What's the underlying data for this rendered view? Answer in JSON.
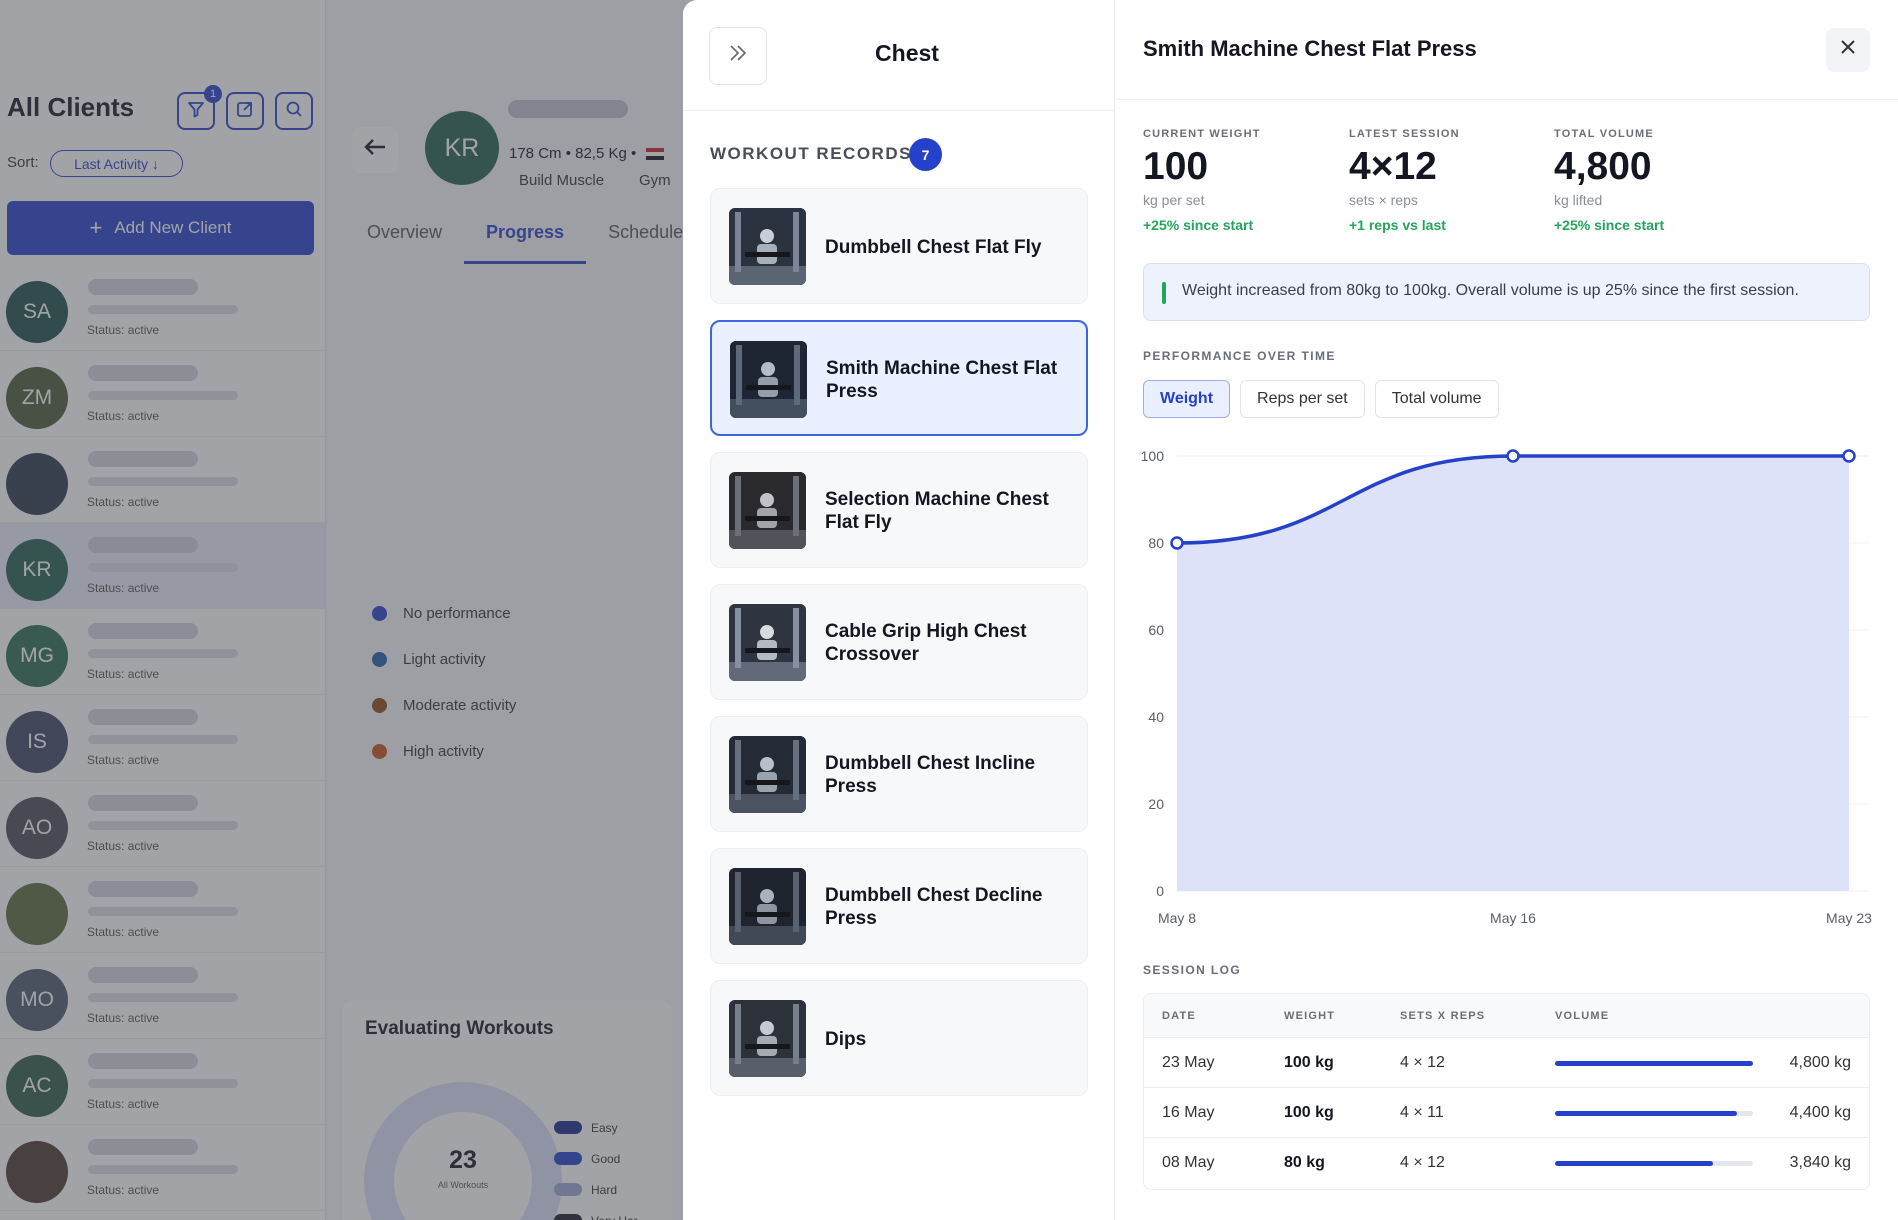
{
  "sidebar": {
    "title": "All Clients",
    "filter_badge": "1",
    "sort_label": "Sort:",
    "sort_value": "Last Activity ↓",
    "add_button": "Add New Client",
    "clients": [
      {
        "initials": "SA",
        "status": "Status: active",
        "color": "#1f4f49",
        "active": false
      },
      {
        "initials": "ZM",
        "status": "Status: active",
        "color": "#4c5a3a",
        "active": false
      },
      {
        "initials": "",
        "status": "Status: active",
        "color": "#2e3b4c",
        "active": false
      },
      {
        "initials": "KR",
        "status": "Status: active",
        "color": "#26604e",
        "active": true
      },
      {
        "initials": "MG",
        "status": "Status: active",
        "color": "#2d6a56",
        "active": false
      },
      {
        "initials": "IS",
        "status": "Status: active",
        "color": "#3c4560",
        "active": false
      },
      {
        "initials": "AO",
        "status": "Status: active",
        "color": "#4a4a55",
        "active": false
      },
      {
        "initials": "",
        "status": "Status: active",
        "color": "#5a6a3a",
        "active": false
      },
      {
        "initials": "MO",
        "status": "Status: active",
        "color": "#4a5a6a",
        "active": false
      },
      {
        "initials": "AC",
        "status": "Status: active",
        "color": "#2e5a4c",
        "active": false
      },
      {
        "initials": "",
        "status": "Status: active",
        "color": "#4c3a2e",
        "active": false
      }
    ]
  },
  "client": {
    "initials": "KR",
    "height": "178 Cm",
    "weight": "82,5 Kg",
    "goal": "Build Muscle",
    "place": "Gym",
    "tabs": [
      "Overview",
      "Progress",
      "Schedule"
    ],
    "active_tab": 1,
    "activity_legend": [
      {
        "label": "No performance",
        "color": "#2540c9"
      },
      {
        "label": "Light activity",
        "color": "#1f5fa8"
      },
      {
        "label": "Moderate activity",
        "color": "#8a4a1a"
      },
      {
        "label": "High activity",
        "color": "#c8501a"
      }
    ],
    "evaluating": {
      "title": "Evaluating Workouts",
      "count": "23",
      "count_label": "All Workouts",
      "legend": [
        {
          "label": "Easy",
          "color": "#1a2a8a"
        },
        {
          "label": "Good",
          "color": "#2540c9"
        },
        {
          "label": "Hard",
          "color": "#9aa6d6"
        },
        {
          "label": "Very Har",
          "color": "#1a1d2a"
        }
      ]
    }
  },
  "exercise_panel": {
    "title": "Chest",
    "records_label": "WORKOUT RECORDS",
    "records_count": "7",
    "selected_index": 1,
    "exercises": [
      {
        "name": "Dumbbell Chest Flat Fly"
      },
      {
        "name": "Smith Machine Chest Flat Press"
      },
      {
        "name": "Selection Machine Chest Flat Fly"
      },
      {
        "name": "Cable Grip High Chest Crossover"
      },
      {
        "name": "Dumbbell Chest Incline Press"
      },
      {
        "name": "Dumbbell Chest Decline Press"
      },
      {
        "name": "Dips"
      }
    ]
  },
  "detail": {
    "title": "Smith Machine Chest Flat Press",
    "stats": [
      {
        "label": "CURRENT WEIGHT",
        "value": "100",
        "sub": "kg per set",
        "delta": "+25% since start"
      },
      {
        "label": "LATEST SESSION",
        "value": "4×12",
        "sub": "sets × reps",
        "delta": "+1 reps vs last"
      },
      {
        "label": "TOTAL VOLUME",
        "value": "4,800",
        "sub": "kg lifted",
        "delta": "+25% since start"
      }
    ],
    "insight": "Weight increased from 80kg to 100kg. Overall volume is up 25% since the first session.",
    "performance_label": "PERFORMANCE OVER TIME",
    "metric_tabs": [
      "Weight",
      "Reps per set",
      "Total volume"
    ],
    "active_metric": 0,
    "session_log_label": "SESSION LOG",
    "table_headers": [
      "DATE",
      "WEIGHT",
      "SETS X REPS",
      "VOLUME"
    ],
    "sessions": [
      {
        "date": "23 May",
        "weight": "100 kg",
        "sets_reps": "4 × 12",
        "volume": "4,800 kg",
        "fraction": 1.0
      },
      {
        "date": "16 May",
        "weight": "100 kg",
        "sets_reps": "4 × 11",
        "volume": "4,400 kg",
        "fraction": 0.917
      },
      {
        "date": "08 May",
        "weight": "80 kg",
        "sets_reps": "4 × 12",
        "volume": "3,840 kg",
        "fraction": 0.8
      }
    ]
  },
  "colors": {
    "accent": "#2540c9",
    "positive": "#23a55a",
    "chart_fill": "#dde2f9"
  },
  "chart_data": {
    "type": "area",
    "x": [
      "May 8",
      "May 16",
      "May 23"
    ],
    "series": [
      {
        "values": [
          80,
          100,
          100
        ]
      }
    ],
    "yticks": [
      0,
      20,
      40,
      60,
      80,
      100
    ],
    "ylim": [
      0,
      100
    ],
    "grid": true
  }
}
